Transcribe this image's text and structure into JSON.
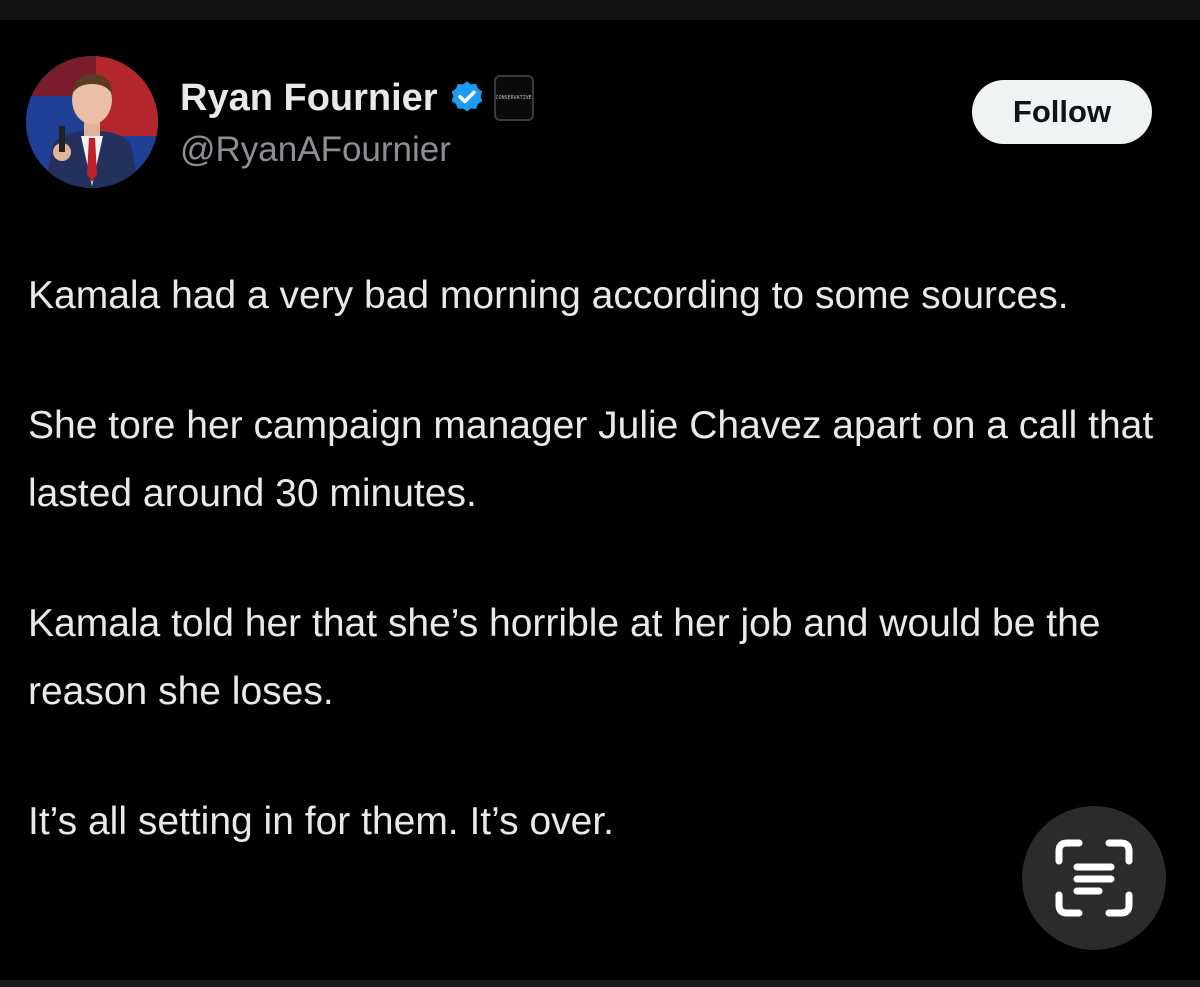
{
  "author": {
    "display_name": "Ryan Fournier",
    "handle": "@RyanAFournier",
    "verified": true,
    "verified_icon": "verified-badge-icon",
    "affiliation_icon": "affiliation-badge-icon",
    "affiliation_text": "CONSERVATIVE",
    "avatar_icon": "profile-photo"
  },
  "actions": {
    "follow_label": "Follow"
  },
  "tweet": {
    "paragraphs": [
      "Kamala had a very bad morning according to some sources.",
      "She tore her campaign manager Julie Chavez apart on a call that lasted around 30 minutes.",
      "Kamala told her that she’s horrible at her job and would be the reason she loses.",
      "It’s all setting in for them. It’s over."
    ]
  },
  "overlay": {
    "scan_icon": "text-scan-icon"
  },
  "colors": {
    "background": "#000000",
    "primary_text": "#e7e9ea",
    "secondary_text": "#8b8f94",
    "verified_blue": "#1d9bf0",
    "follow_button_bg": "#eff3f4",
    "follow_button_text": "#0f1419",
    "scan_button_bg": "#2b2b2d"
  }
}
